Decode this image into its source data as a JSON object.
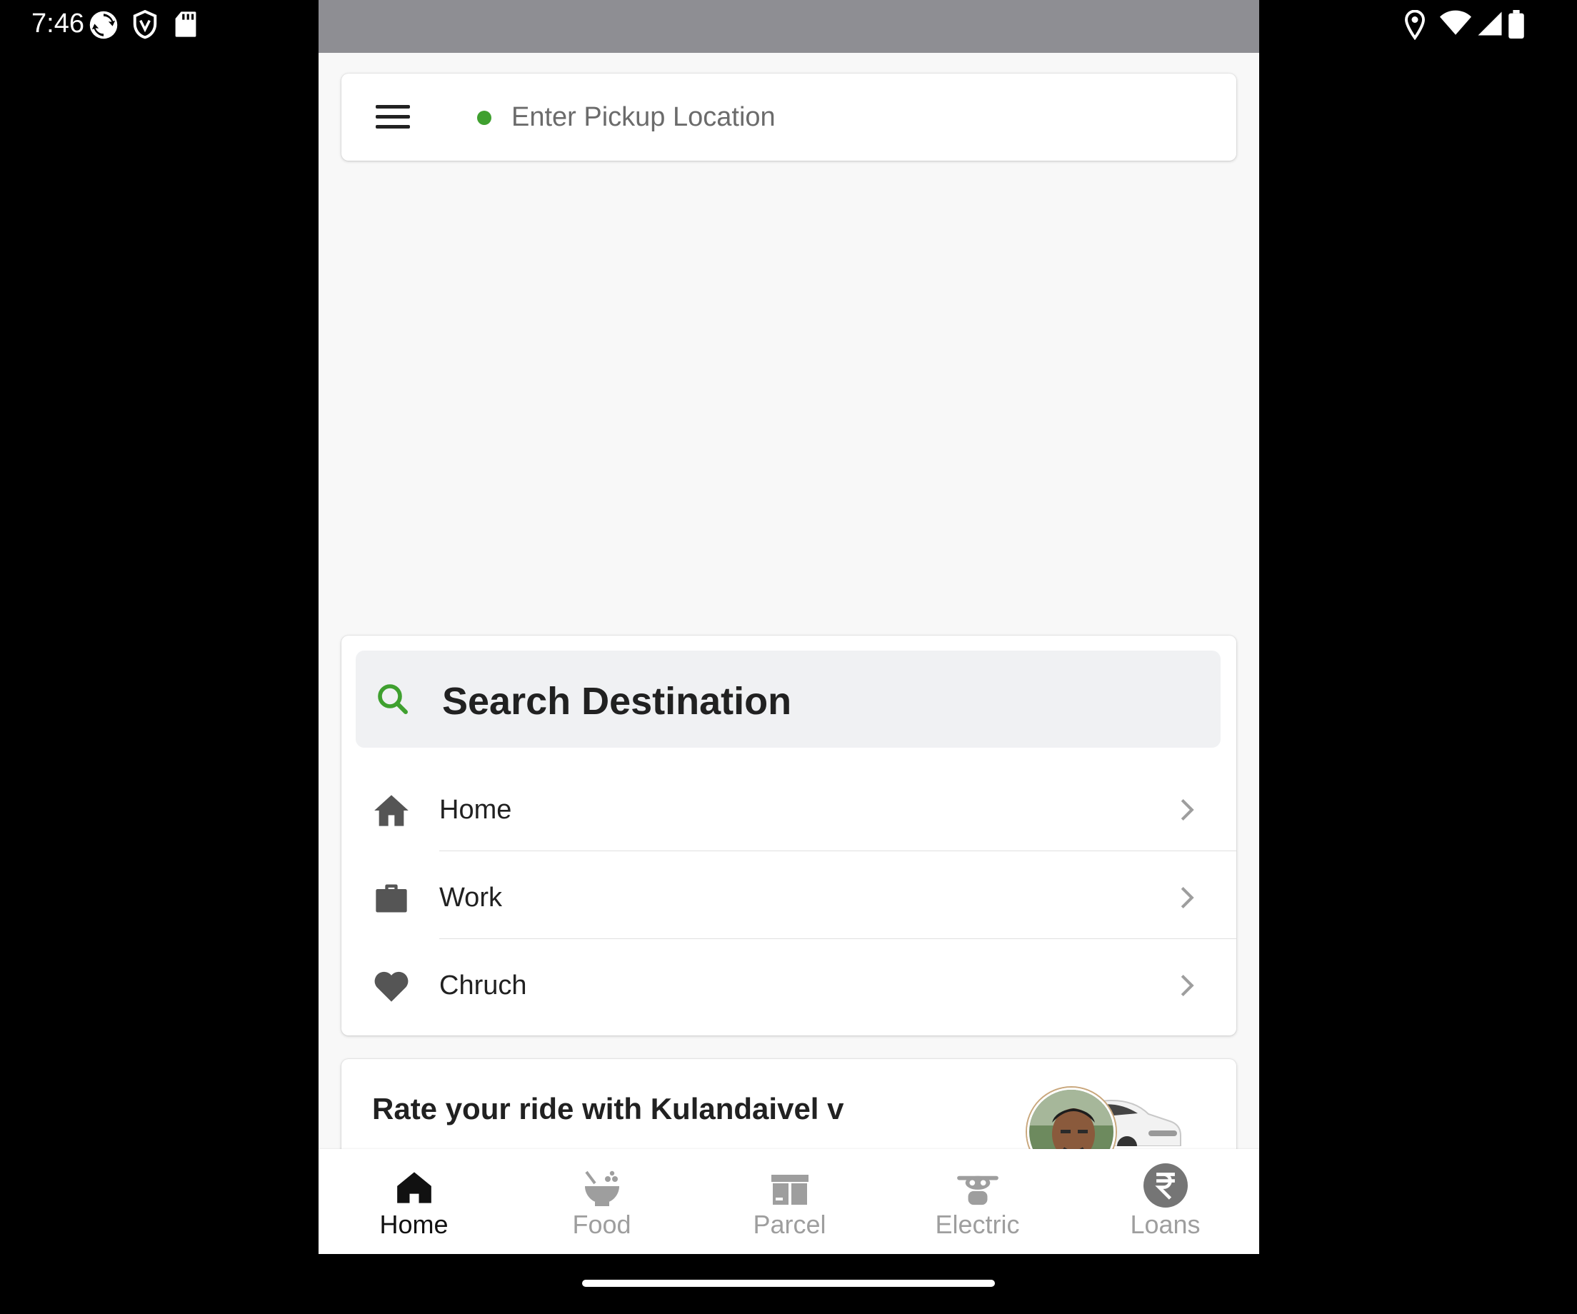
{
  "status_bar": {
    "time": "7:46",
    "left_icons": [
      "sync-icon",
      "shield-icon",
      "sd-card-icon"
    ],
    "right_icons": [
      "location-icon",
      "wifi-icon",
      "signal-icon",
      "battery-icon"
    ]
  },
  "pickup": {
    "placeholder": "Enter Pickup Location",
    "status_color": "#3fa02f"
  },
  "destination": {
    "search_label": "Search Destination",
    "saved_places": [
      {
        "label": "Home",
        "icon": "home-icon"
      },
      {
        "label": "Work",
        "icon": "briefcase-icon"
      },
      {
        "label": "Chruch",
        "icon": "heart-icon"
      }
    ]
  },
  "rating": {
    "text": "Rate your ride with Kulandaivel v"
  },
  "bottom_nav": {
    "items": [
      {
        "label": "Home",
        "icon": "home-nav-icon",
        "active": true
      },
      {
        "label": "Food",
        "icon": "food-bowl-icon",
        "active": false
      },
      {
        "label": "Parcel",
        "icon": "parcel-box-icon",
        "active": false
      },
      {
        "label": "Electric",
        "icon": "electric-scooter-icon",
        "active": false
      },
      {
        "label": "Loans",
        "icon": "rupee-icon",
        "active": false
      }
    ]
  },
  "colors": {
    "accent_green": "#3fa02f",
    "top_strip": "#8e8e93",
    "icon_grey": "#555555"
  }
}
